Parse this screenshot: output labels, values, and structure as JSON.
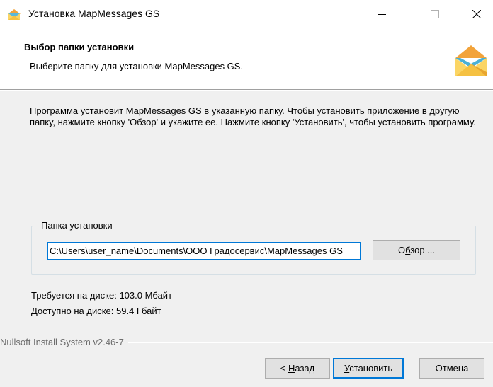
{
  "window": {
    "title": "Установка MapMessages GS",
    "icon": "installer-icon"
  },
  "header": {
    "title": "Выбор папки установки",
    "subtitle": "Выберите папку для установки MapMessages GS.",
    "logo": "envelope-logo-icon"
  },
  "description": "Программа установит MapMessages GS в указанную папку. Чтобы установить приложение в другую папку, нажмите кнопку 'Обзор' и укажите ее. Нажмите кнопку 'Установить', чтобы установить программу.",
  "install_folder": {
    "legend": "Папка установки",
    "path": "C:\\Users\\user_name\\Documents\\ООО Градосервис\\MapMessages GS",
    "browse": {
      "before": "О",
      "hotkey": "б",
      "after": "зор ..."
    }
  },
  "disk": {
    "required": "Требуется на диске: 103.0 Мбайт",
    "available": "Доступно на диске: 59.4 Гбайт"
  },
  "footer": {
    "brand": "Nullsoft Install System v2.46-7",
    "back": {
      "prefix": "< ",
      "hotkey": "Н",
      "rest": "азад"
    },
    "install": {
      "hotkey": "У",
      "rest": "становить"
    },
    "cancel": "Отмена"
  },
  "colors": {
    "accent": "#0078d7",
    "background": "#f0f0f0",
    "header_background": "#ffffff"
  }
}
